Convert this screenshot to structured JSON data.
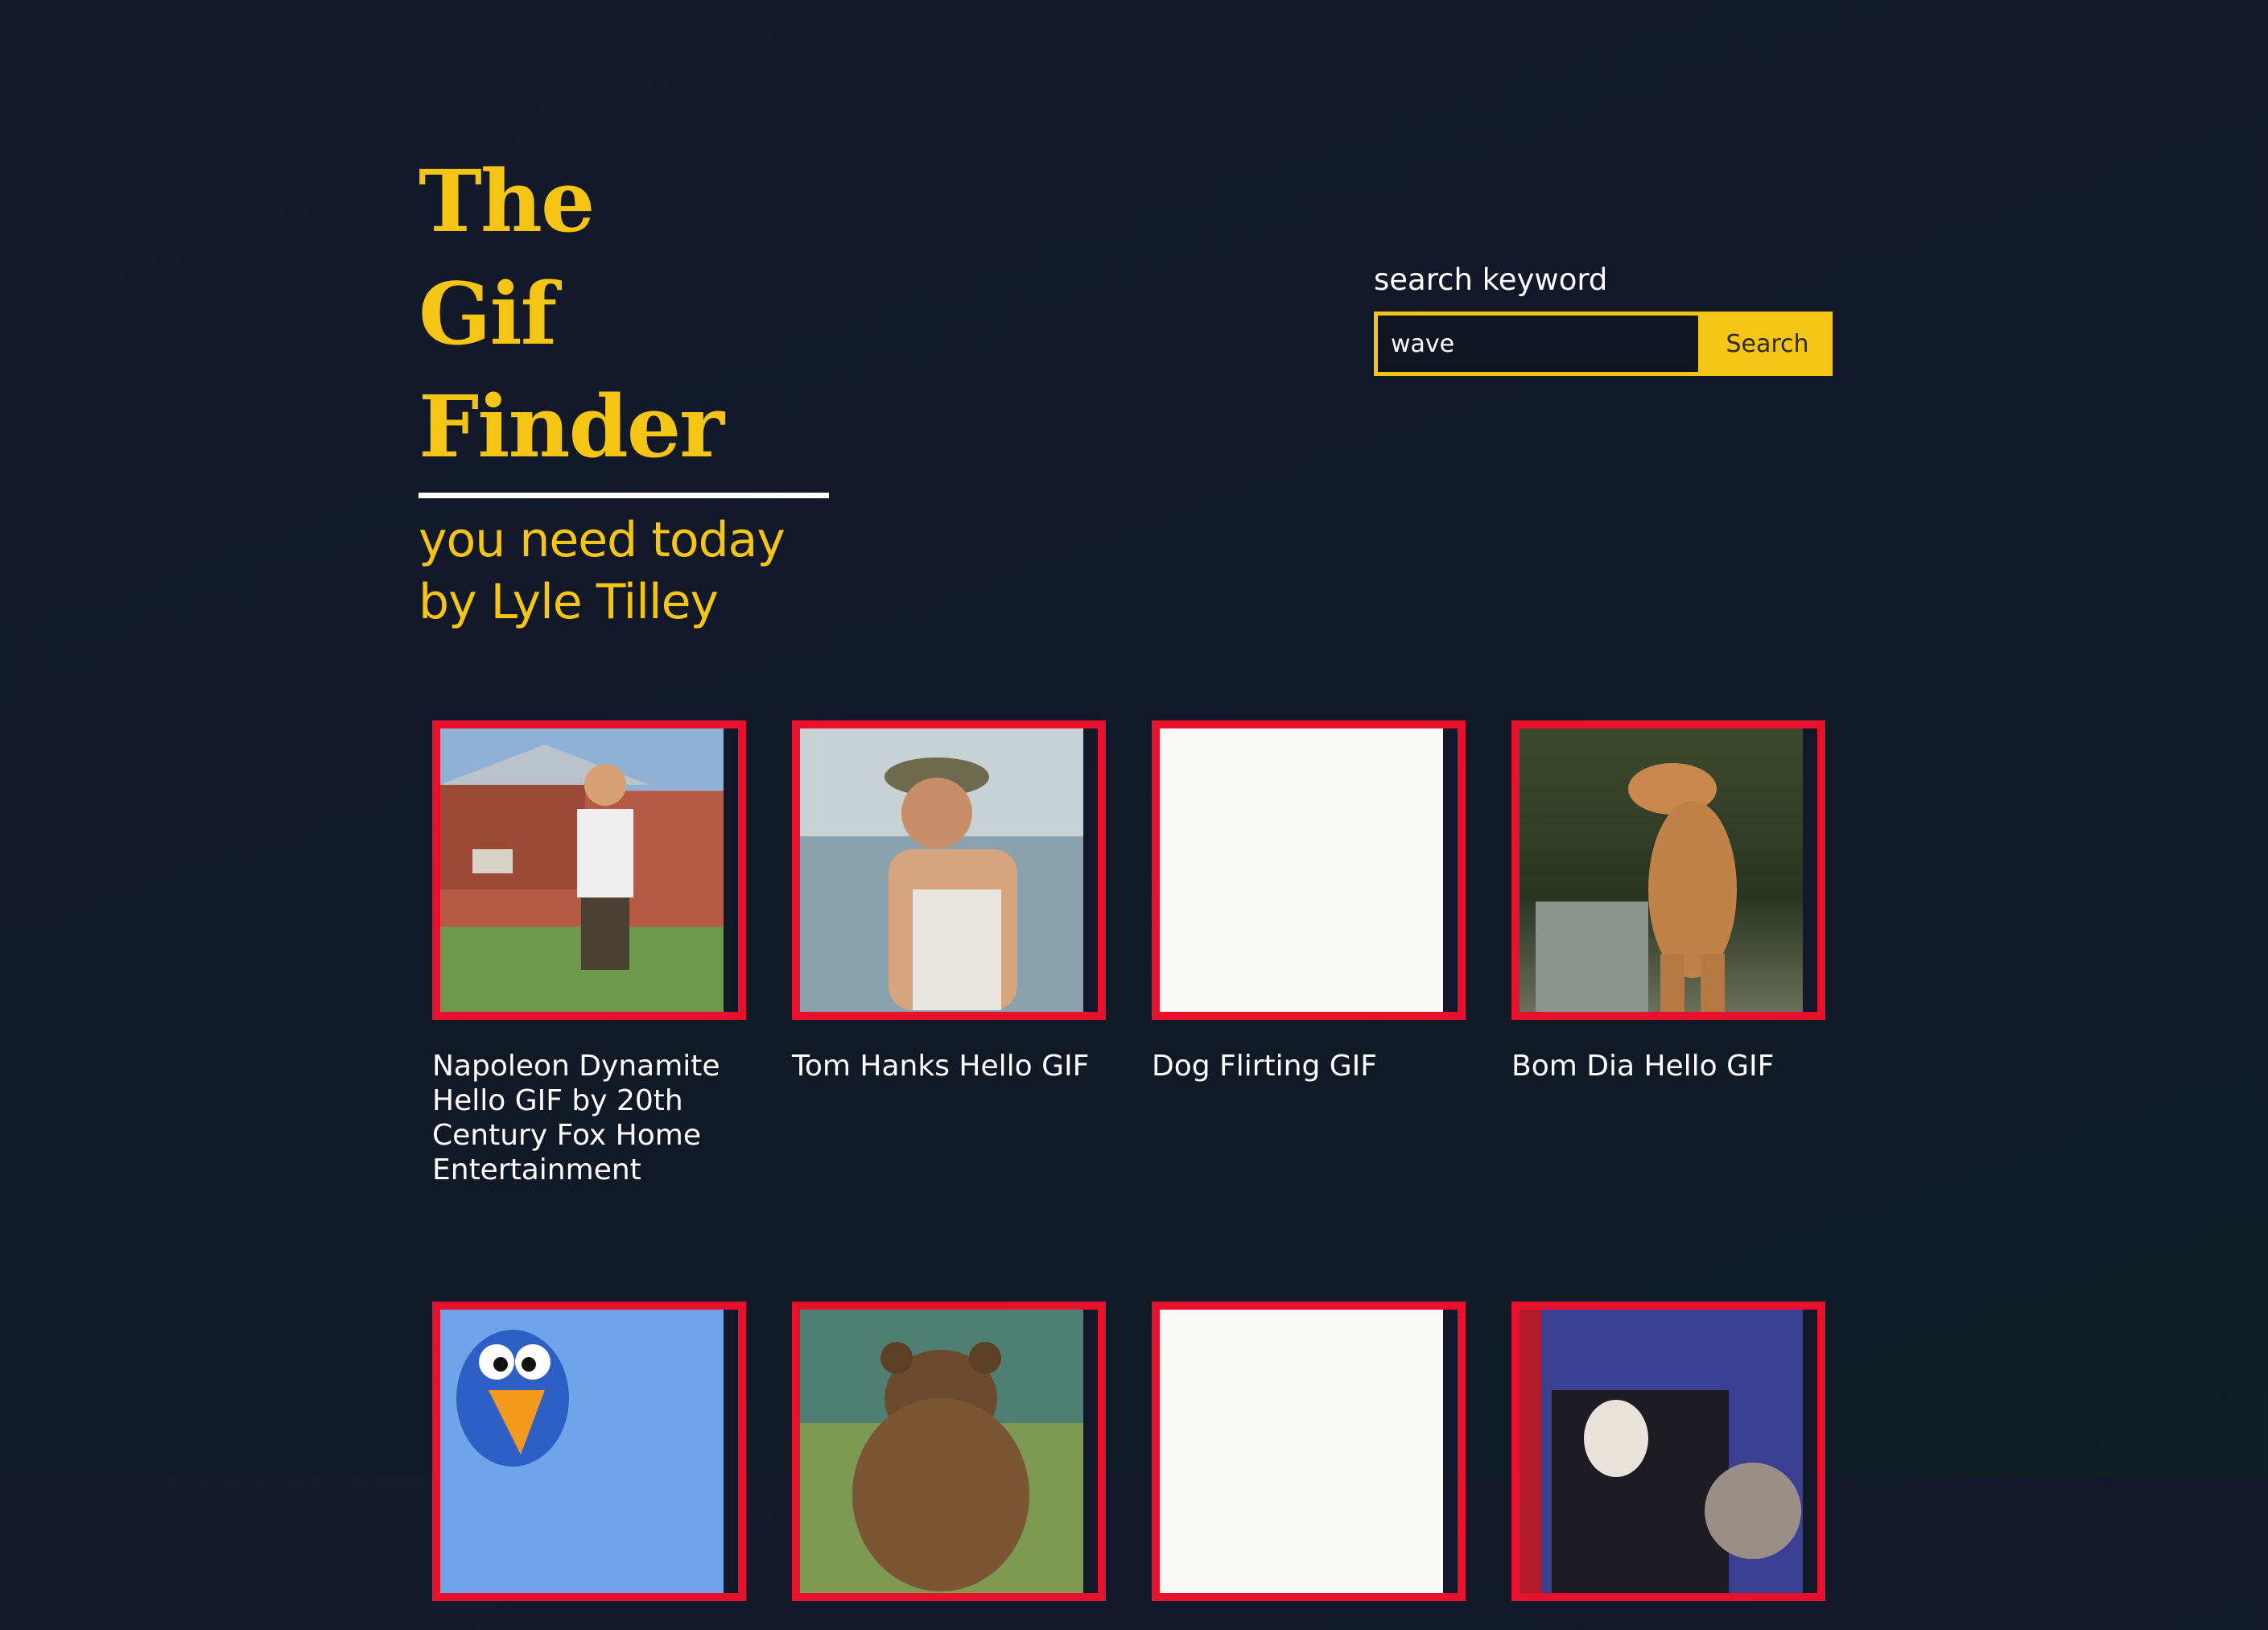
{
  "header": {
    "title_line1": "The",
    "title_line2": "Gif Finder",
    "tagline_line1": "you need today",
    "tagline_line2": "by Lyle Tilley"
  },
  "search": {
    "label": "search keyword",
    "value": "wave",
    "button_label": "Search"
  },
  "colors": {
    "accent": "#f5c516",
    "frame": "#e8112d",
    "background": "#111827"
  },
  "results": [
    {
      "caption": "Napoleon Dynamite Hello GIF by 20th Century Fox Home Entertainment",
      "icon": "napoleon-image"
    },
    {
      "caption": "Tom Hanks Hello GIF",
      "icon": "tom-hanks-image"
    },
    {
      "caption": "Dog Flirting GIF",
      "icon": "blank-image"
    },
    {
      "caption": "Bom Dia Hello GIF",
      "icon": "dinosaur-image"
    },
    {
      "caption": "",
      "icon": "bird-image"
    },
    {
      "caption": "",
      "icon": "bear-image"
    },
    {
      "caption": "",
      "icon": "blank-image"
    },
    {
      "caption": "",
      "icon": "dog-image"
    }
  ]
}
